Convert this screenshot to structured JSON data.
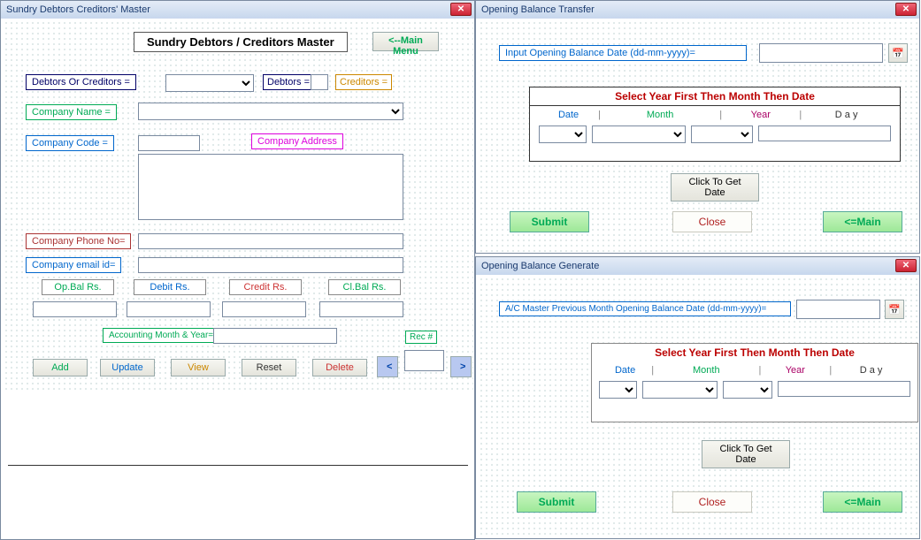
{
  "win1": {
    "title": "Sundry Debtors Creditors' Master",
    "header": "Sundry Debtors / Creditors Master",
    "mainmenu": "<--Main Menu",
    "debtors_or_creditors_label": "Debtors Or Creditors =",
    "debtors_label": "Debtors =",
    "creditors_label": "Creditors =",
    "company_name_label": "Company Name  =",
    "company_code_label": "Company Code   =",
    "company_address_label": "Company Address",
    "company_phone_label": "Company Phone No=",
    "company_email_label": "Company email id=",
    "opbal_label": "Op.Bal Rs.",
    "debit_label": "Debit Rs.",
    "credit_label": "Credit Rs.",
    "clbal_label": "Cl.Bal Rs.",
    "acct_month_year_label": "Accounting Month & Year=",
    "rec_label": "Rec #",
    "add": "Add",
    "update": "Update",
    "view": "View",
    "reset": "Reset",
    "delete": "Delete",
    "prev": "<",
    "next": ">"
  },
  "win2": {
    "title": "Opening Balance Transfer",
    "input_label": "Input Opening Balance Date (dd-mm-yyyy)=",
    "select_header": "Select Year First Then Month Then Date",
    "date": "Date",
    "month": "Month",
    "year": "Year",
    "day": "D a y",
    "click_get_date": "Click To Get Date",
    "submit": "Submit",
    "close": "Close",
    "main": "<=Main"
  },
  "win3": {
    "title": "Opening Balance Generate",
    "input_label": "A/C Master Previous Month Opening Balance Date (dd-mm-yyyy)=",
    "select_header": "Select Year First Then Month Then Date",
    "date": "Date",
    "month": "Month",
    "year": "Year",
    "day": "D a y",
    "click_get_date": "Click To Get Date",
    "submit": "Submit",
    "close": "Close",
    "main": "<=Main"
  }
}
